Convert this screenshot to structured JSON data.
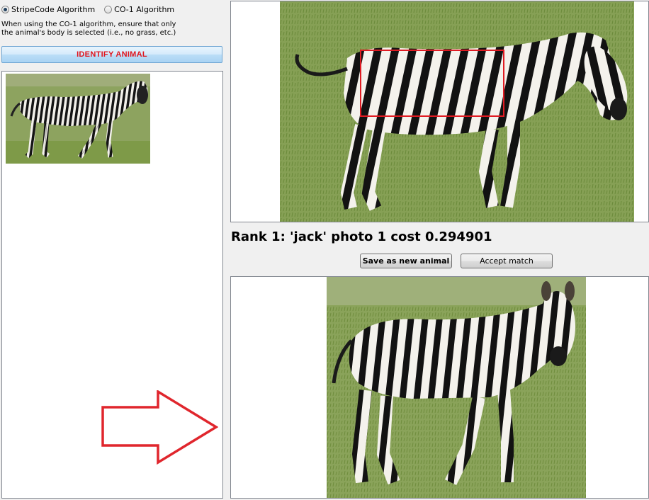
{
  "algorithm": {
    "options": [
      {
        "label": "StripeCode Algorithm",
        "selected": true
      },
      {
        "label": "CO-1 Algorithm",
        "selected": false
      }
    ]
  },
  "hint": {
    "line1": "When using the CO-1 algorithm, ensure that only",
    "line2": "the animal's body is selected (i.e., no grass, etc.)"
  },
  "identify_button": {
    "label": "IDENTIFY ANIMAL"
  },
  "result": {
    "rank_text": "Rank 1: 'jack' photo 1 cost 0.294901"
  },
  "actions": {
    "save_label": "Save as new animal",
    "accept_label": "Accept match"
  },
  "colors": {
    "identify_text": "#e0141c",
    "selection_box": "#e01b22",
    "arrow": "#e0262d",
    "grass": "#7a9a4a"
  },
  "icons": {
    "arrow": "right-arrow-outline-icon"
  }
}
